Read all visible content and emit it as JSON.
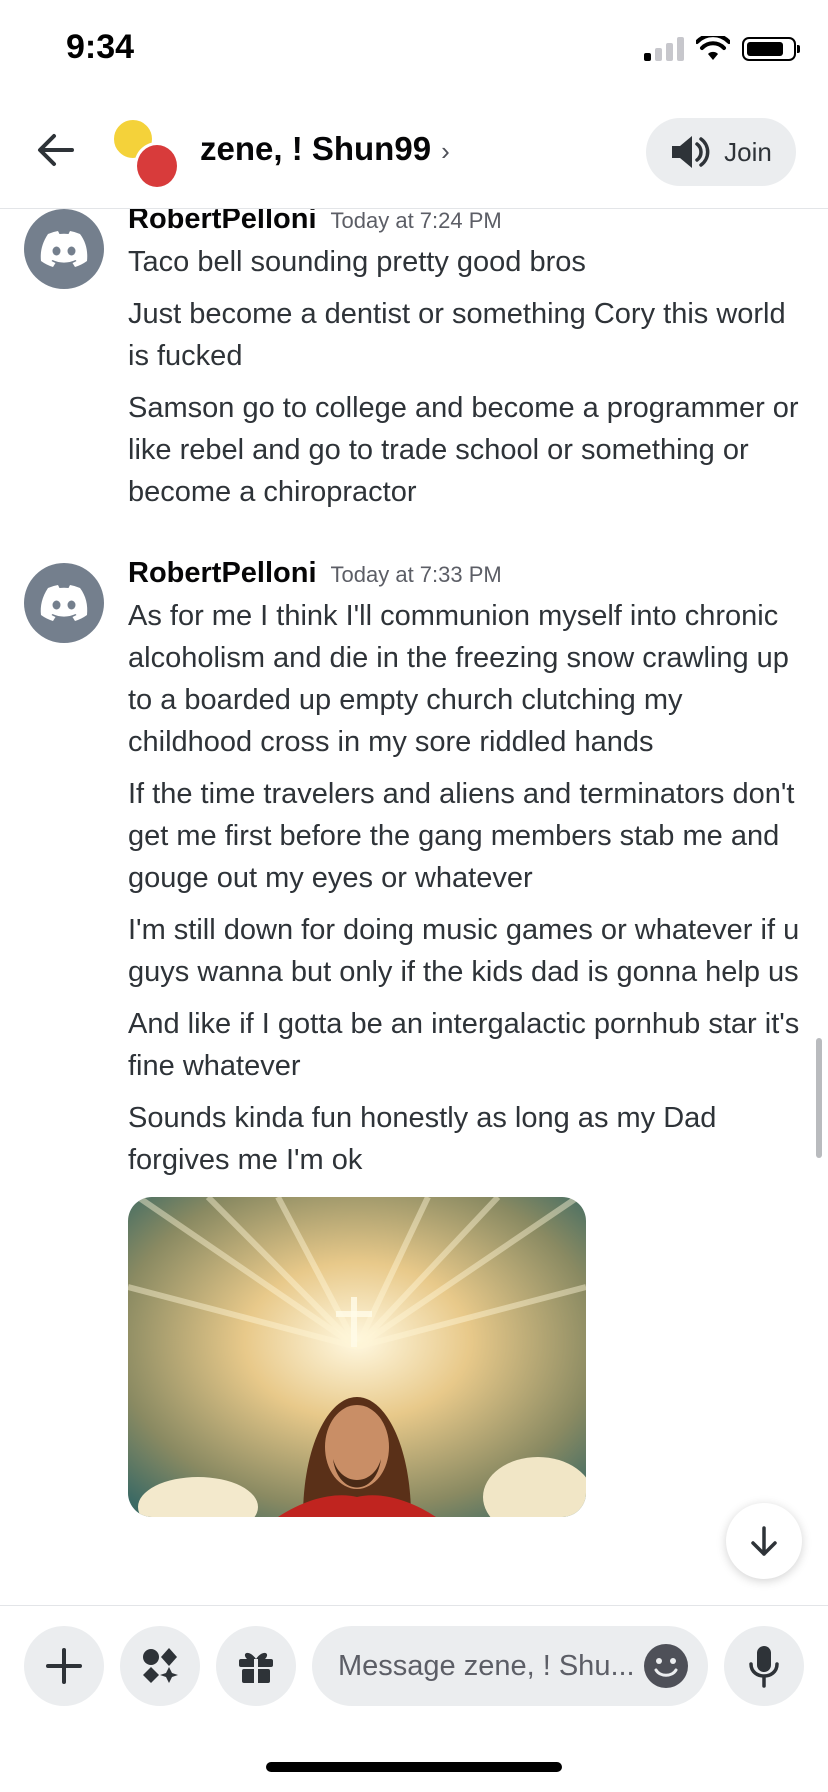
{
  "status_bar": {
    "time": "9:34",
    "signal_bars_active": 1,
    "battery_level_pct": 75
  },
  "header": {
    "channel_title": "zene, ! Shun99",
    "chevron": "›",
    "join_label": "Join",
    "icons": {
      "back": "back-arrow-icon",
      "voice": "speaker-icon"
    }
  },
  "messages": [
    {
      "username": "RobertPelloni",
      "timestamp": "Today at 7:24 PM",
      "lines": [
        "Taco bell sounding pretty good bros",
        "Just become a dentist or something Cory this world is fucked",
        "Samson go to college and become a programmer or like rebel and go to trade school or something or become a chiropractor"
      ]
    },
    {
      "username": "RobertPelloni",
      "timestamp": "Today at 7:33 PM",
      "lines": [
        "As for me I think I'll communion myself into chronic alcoholism and die in the freezing snow crawling up to a boarded up empty church clutching my childhood cross in my sore riddled hands",
        "If the time travelers and aliens and terminators don't get me first before the gang members stab me and gouge out my eyes or whatever",
        "I'm still down for doing music games or whatever if u guys wanna but only if the kids dad is gonna help us",
        "And like if I gotta be an intergalactic pornhub star it's fine whatever",
        "Sounds kinda fun honestly as long as my Dad forgives me I'm ok"
      ]
    }
  ],
  "composer": {
    "placeholder": "Message zene, ! Shu...",
    "icons": [
      "plus-icon",
      "apps-icon",
      "gift-icon",
      "emoji-icon",
      "microphone-icon"
    ]
  },
  "colors": {
    "discord_avatar": "#747f8d",
    "pill_bg": "#ebedef",
    "text": "#2e3338",
    "muted": "#5c5e66"
  }
}
